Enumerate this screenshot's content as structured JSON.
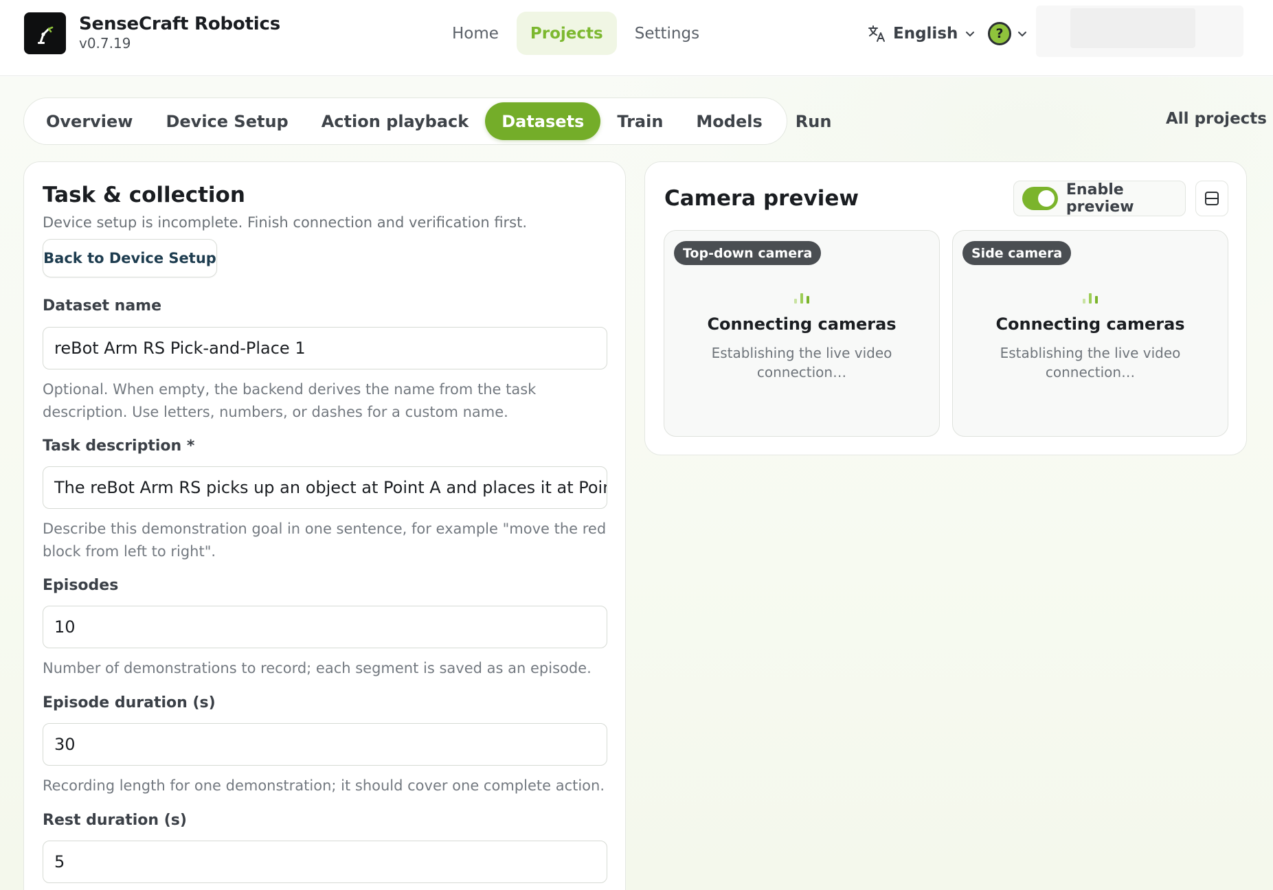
{
  "header": {
    "app_name": "SenseCraft Robotics",
    "version": "v0.7.19",
    "nav": [
      {
        "label": "Home",
        "active": false
      },
      {
        "label": "Projects",
        "active": true
      },
      {
        "label": "Settings",
        "active": false
      }
    ],
    "language": "English"
  },
  "tabs": [
    {
      "label": "Overview",
      "active": false
    },
    {
      "label": "Device Setup",
      "active": false
    },
    {
      "label": "Action playback",
      "active": false
    },
    {
      "label": "Datasets",
      "active": true
    },
    {
      "label": "Train",
      "active": false
    },
    {
      "label": "Models",
      "active": false
    },
    {
      "label": "Run",
      "active": false
    }
  ],
  "all_projects_label": "All projects",
  "task": {
    "title": "Task & collection",
    "subtitle": "Device setup is incomplete. Finish connection and verification first.",
    "back_button": "Back to Device Setup",
    "fields": {
      "dataset_name": {
        "label": "Dataset name",
        "value": "reBot Arm RS Pick-and-Place 1",
        "help": "Optional. When empty, the backend derives the name from the task description. Use letters, numbers, or dashes for a custom name."
      },
      "task_description": {
        "label": "Task description *",
        "value": "The reBot Arm RS picks up an object at Point A and places it at Point B.",
        "help": "Describe this demonstration goal in one sentence, for example \"move the red block from left to right\"."
      },
      "episodes": {
        "label": "Episodes",
        "value": "10",
        "help": "Number of demonstrations to record; each segment is saved as an episode."
      },
      "episode_duration": {
        "label": "Episode duration (s)",
        "value": "30",
        "help": "Recording length for one demonstration; it should cover one complete action."
      },
      "rest_duration": {
        "label": "Rest duration (s)",
        "value": "5"
      }
    }
  },
  "preview": {
    "title": "Camera preview",
    "toggle_label": "Enable preview",
    "toggle_on": true,
    "cameras": [
      {
        "badge": "Top-down camera",
        "status_title": "Connecting cameras",
        "status_text": "Establishing the live video connection…"
      },
      {
        "badge": "Side camera",
        "status_title": "Connecting cameras",
        "status_text": "Establishing the live video connection…"
      }
    ]
  },
  "colors": {
    "accent": "#74ad29",
    "accent_text": "#7cb82f",
    "accent_soft": "#f0f6e4",
    "badge_bg": "#4a4e52"
  }
}
